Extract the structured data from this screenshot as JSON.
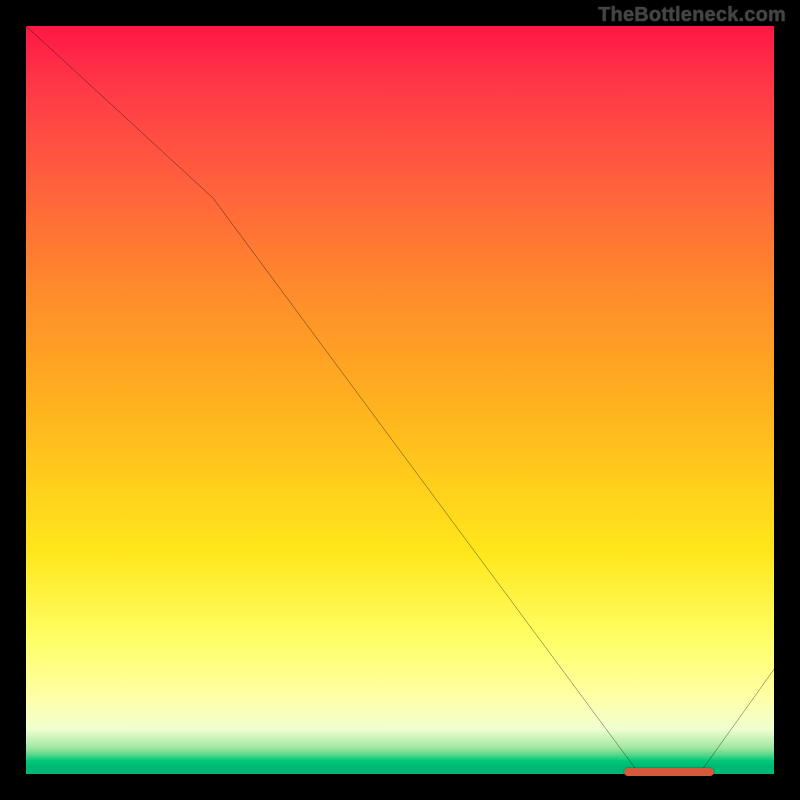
{
  "watermark": "TheBottleneck.com",
  "colors": {
    "frame": "#000000",
    "curve": "#000000",
    "marker": "#d45a3b",
    "gradient_top": "#ff1744",
    "gradient_bottom": "#00b873"
  },
  "chart_data": {
    "type": "line",
    "title": "",
    "xlabel": "",
    "ylabel": "",
    "xlim": [
      0,
      100
    ],
    "ylim": [
      0,
      100
    ],
    "grid": false,
    "legend": false,
    "note": "Axes are normalized 0–100; no tick labels shown in source image, so values are relative.",
    "series": [
      {
        "name": "bottleneck-curve",
        "points": [
          {
            "x": 0,
            "y": 100
          },
          {
            "x": 25,
            "y": 77
          },
          {
            "x": 82,
            "y": 0
          },
          {
            "x": 90,
            "y": 0
          },
          {
            "x": 100,
            "y": 14
          }
        ]
      }
    ],
    "annotations": [
      {
        "name": "optimal-range-marker",
        "x_start": 80,
        "x_end": 92,
        "y": 0
      }
    ]
  }
}
